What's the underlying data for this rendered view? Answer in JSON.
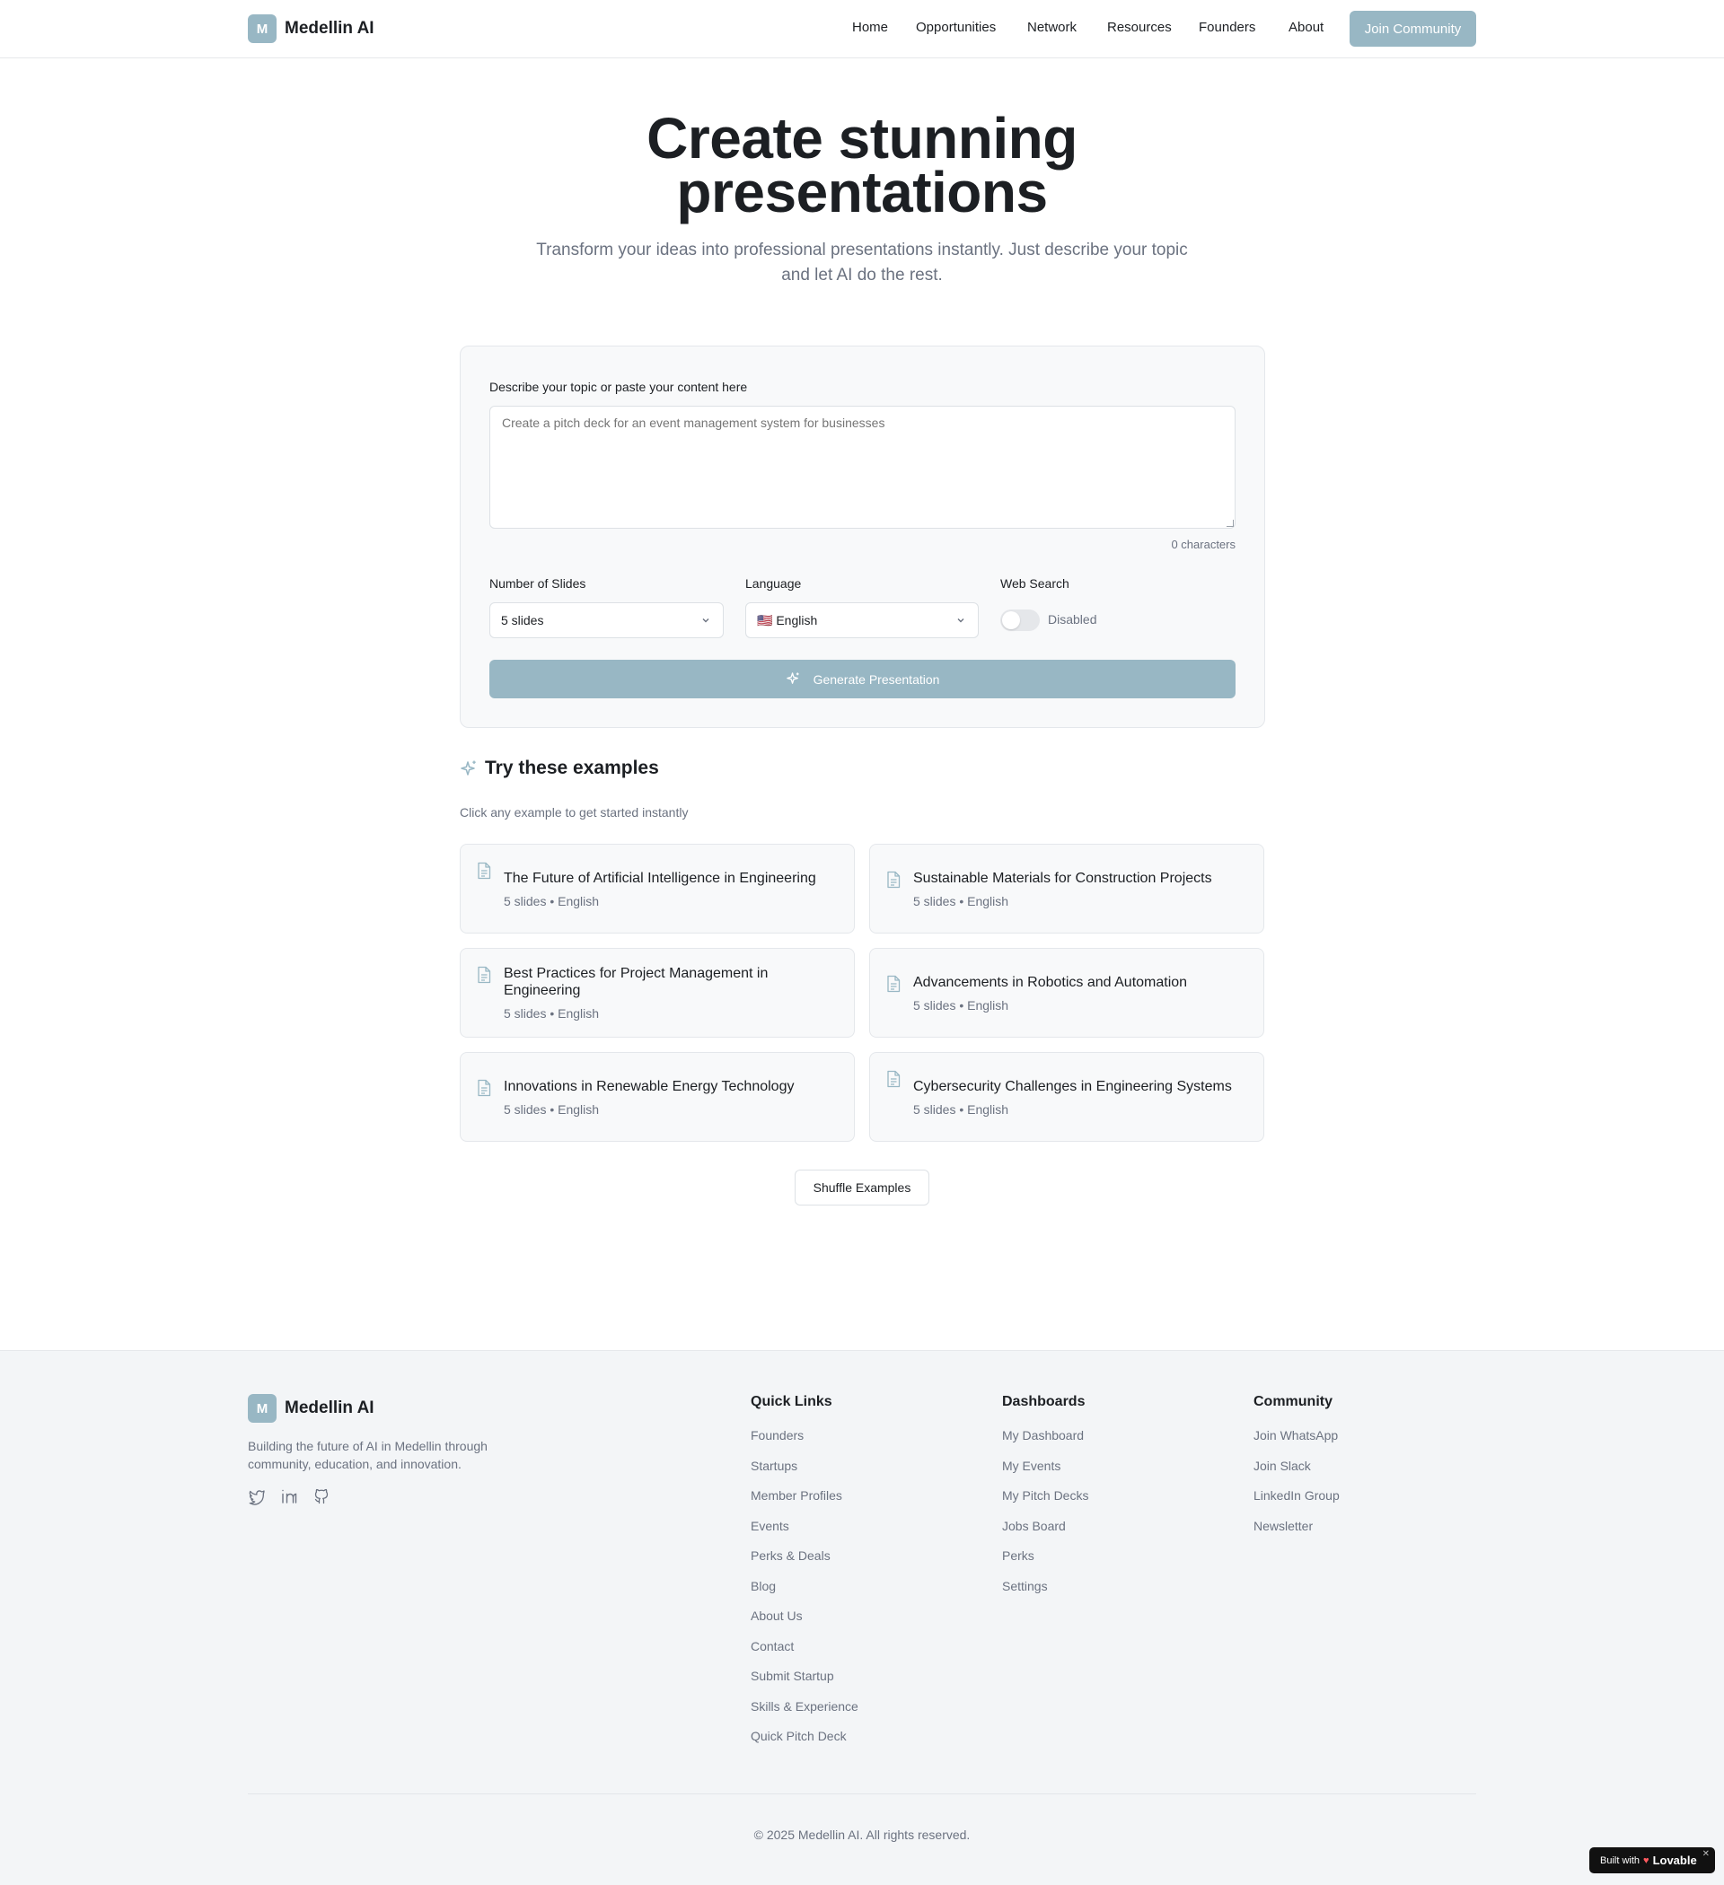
{
  "header": {
    "logo_letter": "M",
    "brand": "Medellin AI",
    "nav": [
      "Home",
      "Opportunities",
      "Network",
      "Resources",
      "Founders",
      "About"
    ],
    "cta": "Join Community"
  },
  "hero": {
    "title": "Create stunning presentations",
    "subtitle": "Transform your ideas into professional presentations instantly. Just describe your topic and let AI do the rest."
  },
  "form": {
    "topic_label": "Describe your topic or paste your content here",
    "topic_placeholder": "Create a pitch deck for an event management system for businesses",
    "char_count": "0 characters",
    "slides_label": "Number of Slides",
    "slides_value": "5 slides",
    "language_label": "Language",
    "language_value": "🇺🇸 English",
    "websearch_label": "Web Search",
    "websearch_state": "Disabled",
    "generate_label": "Generate Presentation"
  },
  "examples": {
    "title": "Try these examples",
    "subtitle": "Click any example to get started instantly",
    "items": [
      {
        "title": "The Future of Artificial Intelligence in Engineering",
        "meta": "5 slides • English"
      },
      {
        "title": "Sustainable Materials for Construction Projects",
        "meta": "5 slides • English"
      },
      {
        "title": "Best Practices for Project Management in Engineering",
        "meta": "5 slides • English"
      },
      {
        "title": "Advancements in Robotics and Automation",
        "meta": "5 slides • English"
      },
      {
        "title": "Innovations in Renewable Energy Technology",
        "meta": "5 slides • English"
      },
      {
        "title": "Cybersecurity Challenges in Engineering Systems",
        "meta": "5 slides • English"
      }
    ],
    "shuffle_label": "Shuffle Examples"
  },
  "footer": {
    "logo_letter": "M",
    "brand": "Medellin AI",
    "description": "Building the future of AI in Medellin through community, education, and innovation.",
    "socials": [
      "twitter-icon",
      "linkedin-icon",
      "github-icon"
    ],
    "columns": [
      {
        "title": "Quick Links",
        "links": [
          "Founders",
          "Startups",
          "Member Profiles",
          "Events",
          "Perks & Deals",
          "Blog",
          "About Us",
          "Contact",
          "Submit Startup",
          "Skills & Experience",
          "Quick Pitch Deck"
        ]
      },
      {
        "title": "Dashboards",
        "links": [
          "My Dashboard",
          "My Events",
          "My Pitch Decks",
          "Jobs Board",
          "Perks",
          "Settings"
        ]
      },
      {
        "title": "Community",
        "links": [
          "Join WhatsApp",
          "Join Slack",
          "LinkedIn Group",
          "Newsletter"
        ]
      }
    ],
    "copyright": "© 2025 Medellin AI. All rights reserved."
  },
  "badge": {
    "prefix": "Built with",
    "name": "Lovable"
  },
  "colors": {
    "accent": "#98b7c4",
    "text": "#1c1f23",
    "muted": "#6b7280",
    "card_bg": "#f8f9fa",
    "footer_bg": "#f3f5f7"
  }
}
